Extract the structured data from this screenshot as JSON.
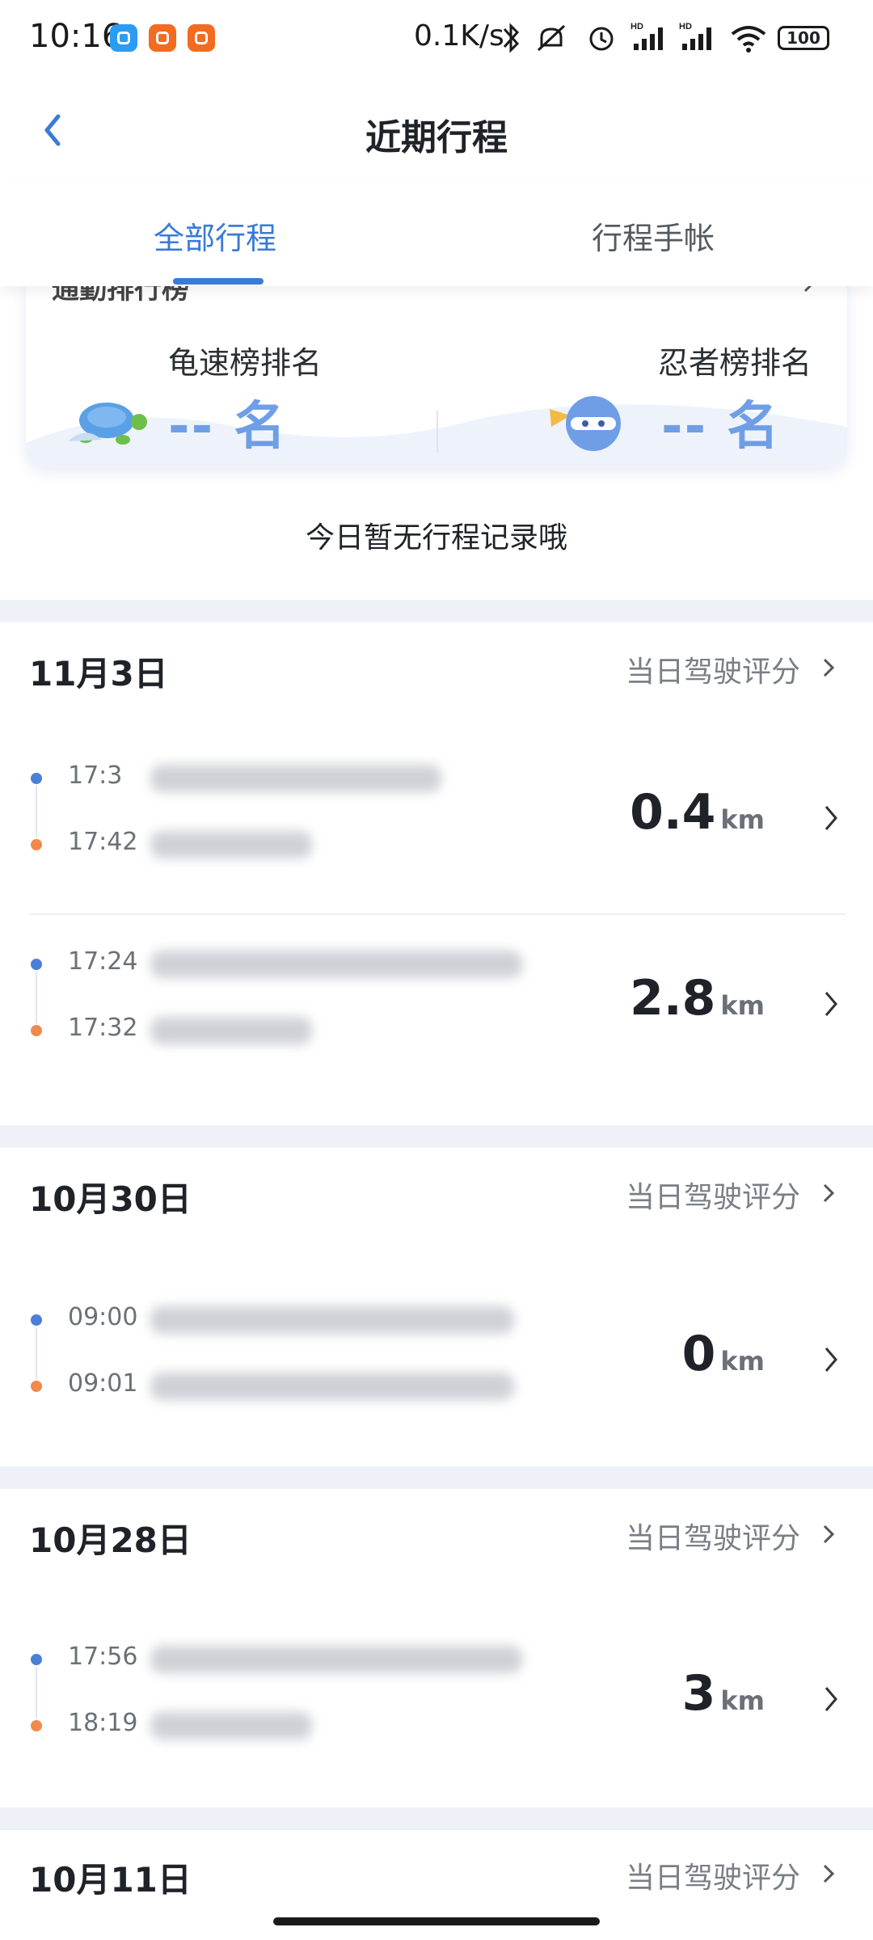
{
  "status_bar": {
    "time": "10:16",
    "network_speed": "0.1K/s",
    "battery": "100",
    "icons": [
      "bluetooth-icon",
      "mute-icon",
      "alarm-icon",
      "signal-hd-icon",
      "signal-hd-icon",
      "wifi-icon",
      "battery-icon"
    ]
  },
  "header": {
    "title": "近期行程"
  },
  "tabs": [
    {
      "label": "全部行程",
      "active": true
    },
    {
      "label": "行程手帐",
      "active": false
    }
  ],
  "ranking": {
    "card_title": "通勤排行榜",
    "turtle_label": "龟速榜排名",
    "turtle_value": "-- 名",
    "ninja_label": "忍者榜排名",
    "ninja_value": "-- 名"
  },
  "empty_message": "今日暂无行程记录哦",
  "days": [
    {
      "date": "11月3日",
      "score_label": "当日驾驶评分",
      "trips": [
        {
          "start_time": "17:3",
          "end_time": "17:42",
          "distance": "0.4",
          "unit": "km"
        },
        {
          "start_time": "17:24",
          "end_time": "17:32",
          "distance": "2.8",
          "unit": "km"
        }
      ]
    },
    {
      "date": "10月30日",
      "score_label": "当日驾驶评分",
      "trips": [
        {
          "start_time": "09:00",
          "end_time": "09:01",
          "distance": "0",
          "unit": "km"
        }
      ]
    },
    {
      "date": "10月28日",
      "score_label": "当日驾驶评分",
      "trips": [
        {
          "start_time": "17:56",
          "end_time": "18:19",
          "distance": "3",
          "unit": "km"
        }
      ]
    },
    {
      "date": "10月11日",
      "score_label": "当日驾驶评分",
      "trips": []
    }
  ],
  "colors": {
    "accent": "#3a7bd5",
    "rank_value": "#6f9ee6",
    "start_dot": "#4a7fd8",
    "end_dot": "#f08a4b",
    "separator": "#eef2f8"
  }
}
